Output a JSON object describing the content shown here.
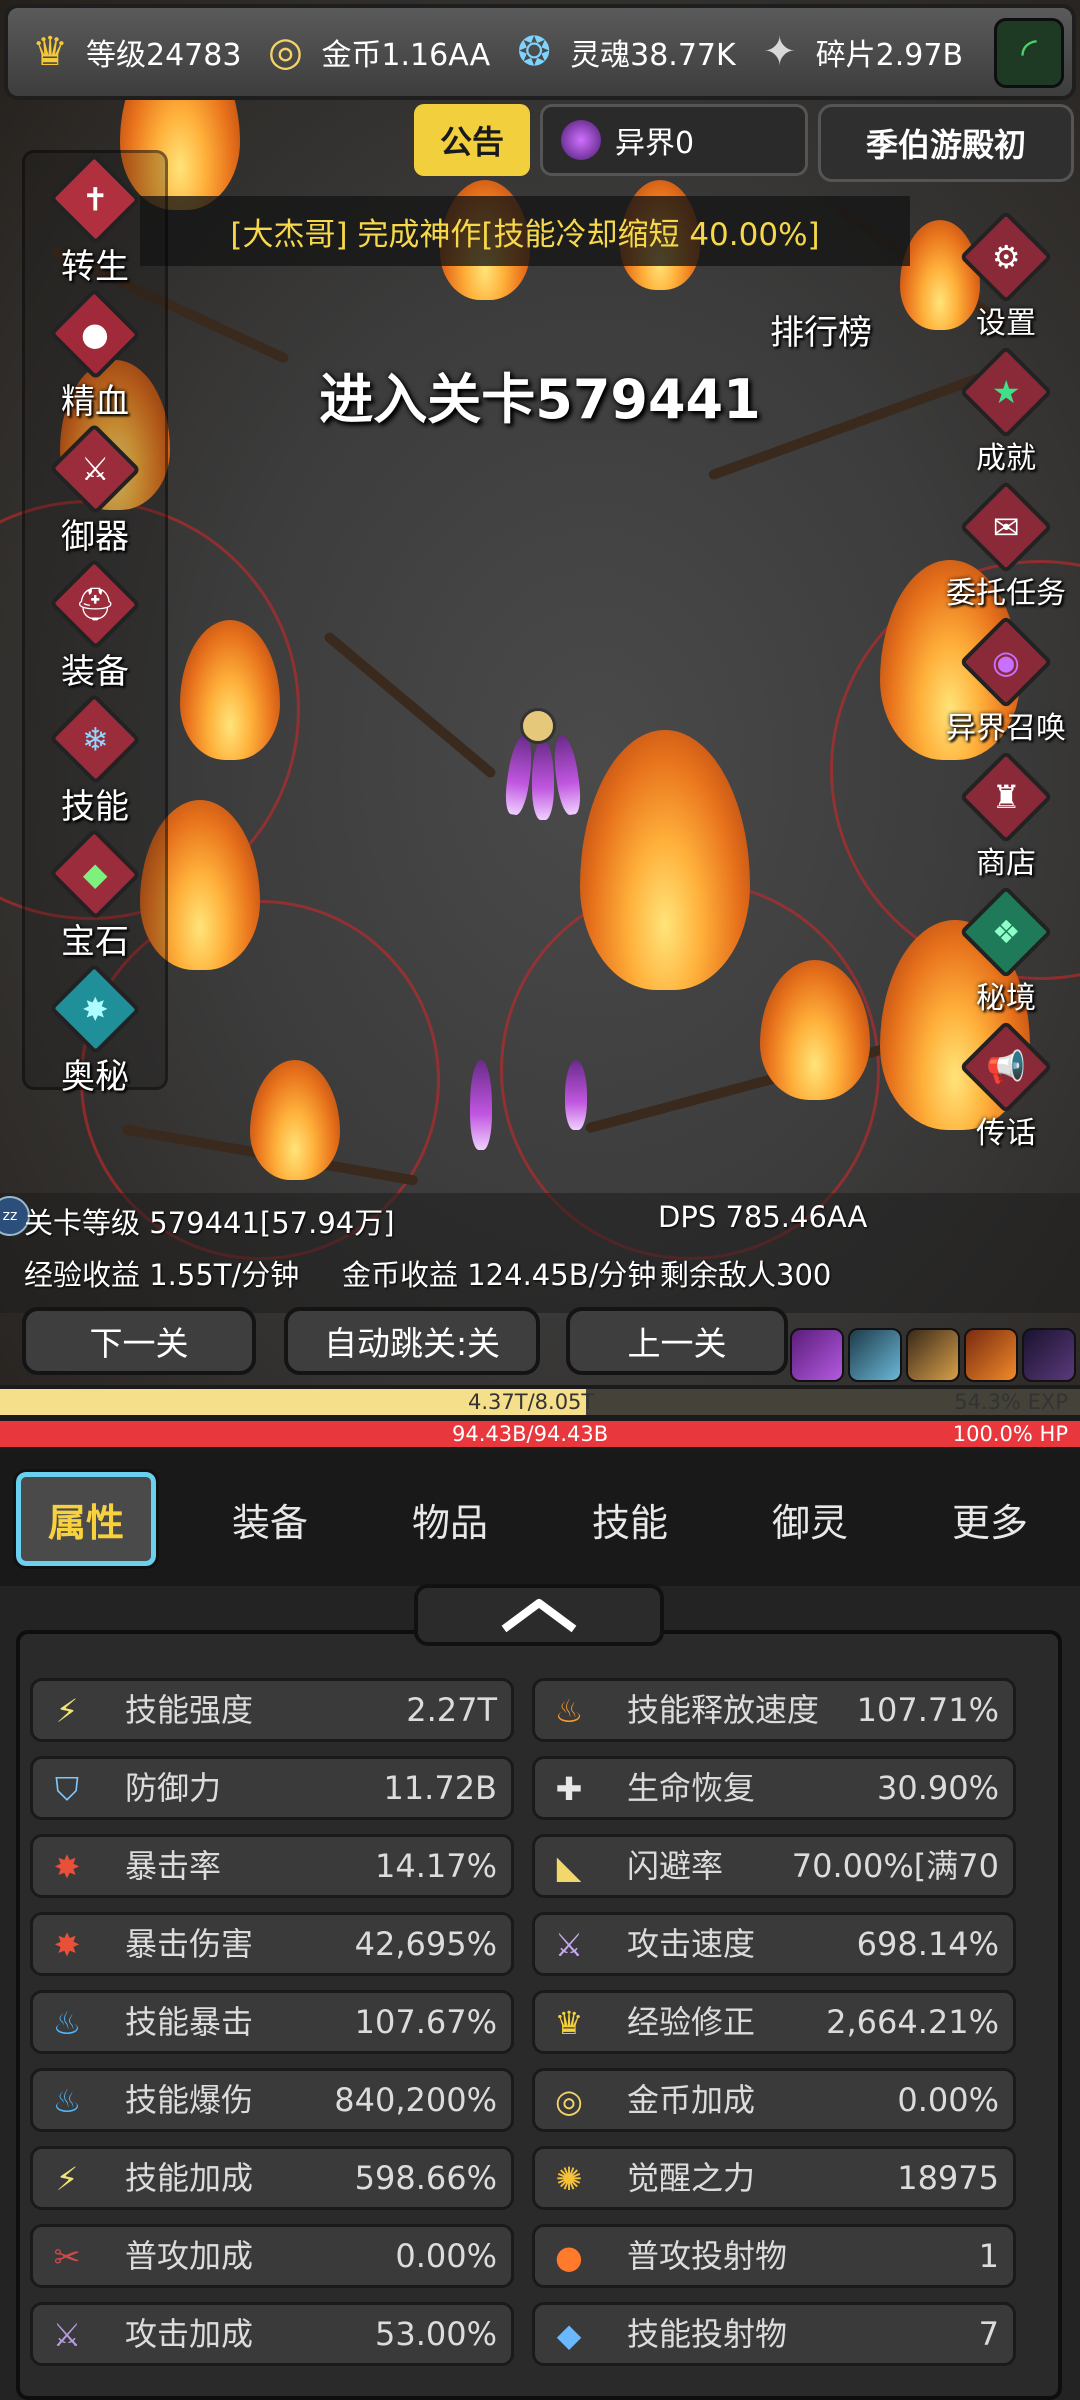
{
  "top_bar": {
    "level": "等级24783",
    "gold": "金币1.16AA",
    "soul": "灵魂38.77K",
    "fragment": "碎片2.97B"
  },
  "notice_label": "公告",
  "otherworld_label": "异界0",
  "player_name": "季伯游殿初",
  "broadcast": "[大杰哥] 完成神作[技能冷却缩短 40.00%]",
  "ranking_label": "排行榜",
  "enter_stage": "进入关卡579441",
  "left_menu": [
    "转生",
    "精血",
    "御器",
    "装备",
    "技能",
    "宝石",
    "奥秘"
  ],
  "right_menu": [
    "设置",
    "成就",
    "委托任务",
    "异界召唤",
    "商店",
    "秘境",
    "传话"
  ],
  "stage_info": {
    "stage_level": "关卡等级 579441[57.94万]",
    "dps": "DPS 785.46AA",
    "exp_income": "经验收益 1.55T/分钟",
    "gold_income": "金币收益 124.45B/分钟",
    "enemies_left": "剩余敌人300"
  },
  "nav": {
    "next": "下一关",
    "auto_skip": "自动跳关:关",
    "prev": "上一关"
  },
  "exp_bar": {
    "value": "4.37T/8.05T",
    "percent": "54.3% EXP",
    "fill": 0.543
  },
  "hp_bar": {
    "value": "94.43B/94.43B",
    "percent": "100.0% HP",
    "fill": 1.0
  },
  "tabs": [
    "属性",
    "装备",
    "物品",
    "技能",
    "御灵",
    "更多"
  ],
  "stats_left": [
    {
      "label": "技能强度",
      "value": "2.27T",
      "icon": "lightning-icon"
    },
    {
      "label": "防御力",
      "value": "11.72B",
      "icon": "shield-icon"
    },
    {
      "label": "暴击率",
      "value": "14.17%",
      "icon": "crit-icon"
    },
    {
      "label": "暴击伤害",
      "value": "42,695%",
      "icon": "crit-icon"
    },
    {
      "label": "技能暴击",
      "value": "107.67%",
      "icon": "blue-flame-icon"
    },
    {
      "label": "技能爆伤",
      "value": "840,200%",
      "icon": "blue-flame-icon"
    },
    {
      "label": "技能加成",
      "value": "598.66%",
      "icon": "lightning-icon"
    },
    {
      "label": "普攻加成",
      "value": "0.00%",
      "icon": "slash-icon"
    },
    {
      "label": "攻击加成",
      "value": "53.00%",
      "icon": "sword-icon"
    }
  ],
  "stats_right": [
    {
      "label": "技能释放速度",
      "value": "107.71%",
      "icon": "fire-icon"
    },
    {
      "label": "生命恢复",
      "value": "30.90%",
      "icon": "cross-icon"
    },
    {
      "label": "闪避率",
      "value": "70.00%[满70",
      "icon": "boot-icon"
    },
    {
      "label": "攻击速度",
      "value": "698.14%",
      "icon": "crossed-swords-icon"
    },
    {
      "label": "经验修正",
      "value": "2,664.21%",
      "icon": "crown-icon"
    },
    {
      "label": "金币加成",
      "value": "0.00%",
      "icon": "coin-icon"
    },
    {
      "label": "觉醒之力",
      "value": "18975",
      "icon": "sun-icon"
    },
    {
      "label": "普攻投射物",
      "value": "1",
      "icon": "fireball-icon"
    },
    {
      "label": "技能投射物",
      "value": "7",
      "icon": "blue-orb-icon"
    }
  ]
}
